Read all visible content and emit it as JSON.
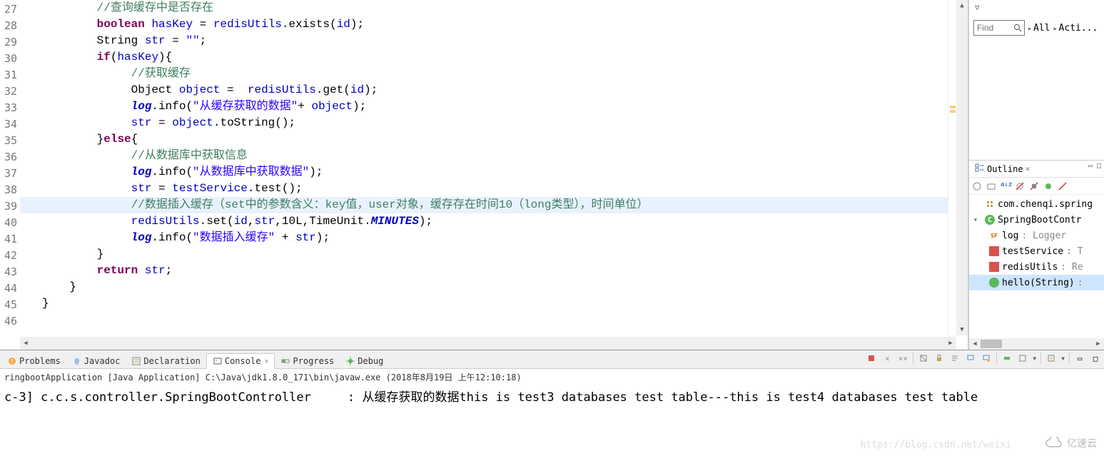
{
  "editor": {
    "lineNumbers": [
      "27",
      "28",
      "29",
      "30",
      "31",
      "32",
      "33",
      "34",
      "35",
      "36",
      "37",
      "38",
      "39",
      "40",
      "41",
      "42",
      "43",
      "44",
      "45",
      "46"
    ],
    "highlightedIndex": 12,
    "code": {
      "l27": "//查询缓存中是否存在",
      "l28_kw": "boolean",
      "l28_var": "hasKey",
      "l28_eq": " = ",
      "l28_field": "redisUtils",
      "l28_rest": ".exists(",
      "l28_arg": "id",
      "l28_end": ");",
      "l29_a": "String ",
      "l29_var": "str",
      "l29_eq": " = ",
      "l29_str": "\"\"",
      "l29_end": ";",
      "l30_kw": "if",
      "l30_a": "(",
      "l30_var": "hasKey",
      "l30_b": "){",
      "l31": "//获取缓存",
      "l32_a": "Object ",
      "l32_var": "object",
      "l32_eq": " =  ",
      "l32_field": "redisUtils",
      "l32_b": ".get(",
      "l32_arg": "id",
      "l32_end": ");",
      "l33_log": "log",
      "l33_a": ".info(",
      "l33_str": "\"从缓存获取的数据\"",
      "l33_b": "+ ",
      "l33_var": "object",
      "l33_end": ");",
      "l34_var1": "str",
      "l34_eq": " = ",
      "l34_var2": "object",
      "l34_rest": ".toString();",
      "l35_a": "}",
      "l35_kw": "else",
      "l35_b": "{",
      "l36": "//从数据库中获取信息",
      "l37_log": "log",
      "l37_a": ".info(",
      "l37_str": "\"从数据库中获取数据\"",
      "l37_end": ");",
      "l38_var": "str",
      "l38_eq": " = ",
      "l38_field": "testService",
      "l38_rest": ".test();",
      "l39": "//数据插入缓存（set中的参数含义：key值，user对象，缓存存在时间10（long类型），时间单位）",
      "l40_field": "redisUtils",
      "l40_a": ".set(",
      "l40_arg1": "id",
      "l40_c1": ",",
      "l40_arg2": "str",
      "l40_c2": ",10L,TimeUnit.",
      "l40_static": "MINUTES",
      "l40_end": ");",
      "l41_log": "log",
      "l41_a": ".info(",
      "l41_str": "\"数据插入缓存\"",
      "l41_b": " + ",
      "l41_var": "str",
      "l41_end": ");",
      "l42": "}",
      "l43_kw": "return",
      "l43_sp": " ",
      "l43_var": "str",
      "l43_end": ";",
      "l44": "}",
      "l45": "}"
    }
  },
  "find": {
    "placeholder": "Find",
    "allLink": "All",
    "actiLink": "Acti..."
  },
  "outline": {
    "title": "Outline",
    "items": {
      "package": "com.chenqi.spring",
      "class": "SpringBootContr",
      "log": "log",
      "logType": " : Logger",
      "testService": "testService",
      "testServiceType": " : T",
      "redisUtils": "redisUtils",
      "redisUtilsType": " : Re",
      "hello": "hello(String)",
      "helloType": " : "
    }
  },
  "tabs": {
    "problems": "Problems",
    "javadoc": "Javadoc",
    "declaration": "Declaration",
    "console": "Console",
    "progress": "Progress",
    "debug": "Debug"
  },
  "console": {
    "title": "ringbootApplication [Java Application] C:\\Java\\jdk1.8.0_171\\bin\\javaw.exe (2018年8月19日 上午12:10:18)",
    "output": "c-3] c.c.s.controller.SpringBootController     : 从缓存获取的数据this is test3 databases test table---this is test4 databases test table"
  },
  "watermark": {
    "url": "https://blog.csdn.net/weixi",
    "brand": "亿速云"
  }
}
